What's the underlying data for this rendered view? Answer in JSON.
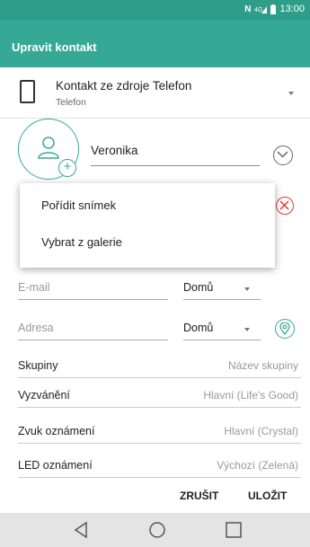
{
  "status_bar": {
    "time": "13:00"
  },
  "app_bar": {
    "title": "Upravit kontakt"
  },
  "account": {
    "label": "Kontakt ze zdroje Telefon",
    "sub_label": "Telefon"
  },
  "name": {
    "value": "Veronika"
  },
  "photo_menu": {
    "items": [
      "Pořídit snímek",
      "Vybrat z galerie"
    ]
  },
  "email": {
    "placeholder": "E-mail",
    "type": "Domů"
  },
  "address": {
    "placeholder": "Adresa",
    "type": "Domů"
  },
  "settings": [
    {
      "label": "Skupiny",
      "value": "Název skupiny"
    },
    {
      "label": "Vyzvánění",
      "value": "Hlavní (Life's Good)"
    },
    {
      "label": "Zvuk oznámení",
      "value": "Hlavní (Crystal)"
    },
    {
      "label": "LED oznámení",
      "value": "Výchozí (Zelená)"
    }
  ],
  "actions": {
    "cancel": "ZRUŠIT",
    "save": "ULOŽIT"
  },
  "colors": {
    "accent": "#35a996",
    "status_bar": "#2e9e8a",
    "remove": "#e53935"
  }
}
